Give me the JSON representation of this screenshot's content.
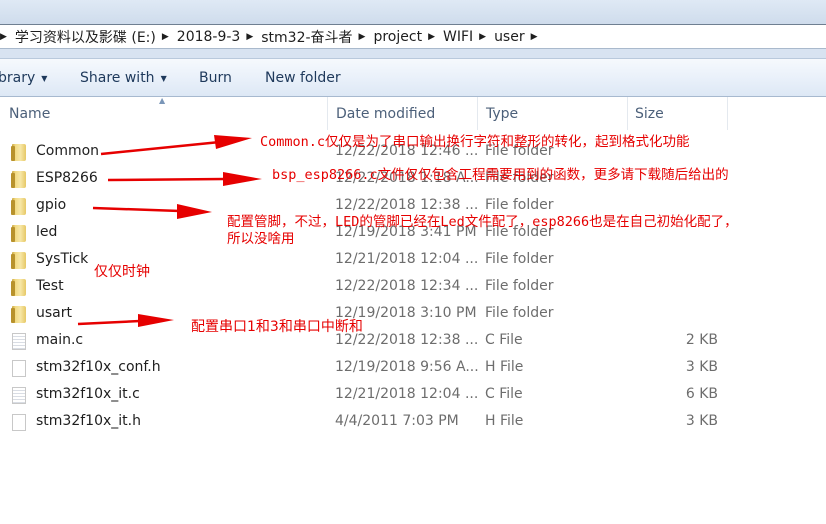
{
  "address_bar": {
    "breadcrumbs": [
      "学习资料以及影碟 (E:)",
      "2018-9-3",
      "stm32-奋斗者",
      "project",
      "WIFI",
      "user"
    ]
  },
  "toolbar": {
    "library_label": "brary",
    "share_with_label": "Share with",
    "burn_label": "Burn",
    "new_folder_label": "New folder"
  },
  "columns": {
    "name": "Name",
    "date_modified": "Date modified",
    "type": "Type",
    "size": "Size",
    "sort_column": "Name",
    "sort_direction": "ascending"
  },
  "files": [
    {
      "name": "Common",
      "date": "12/22/2018 12:46 ...",
      "type": "File folder",
      "size": "",
      "icon": "folder-icon"
    },
    {
      "name": "ESP8266",
      "date": "12/22/2018 1:18 A...",
      "type": "File folder",
      "size": "",
      "icon": "folder-icon"
    },
    {
      "name": "gpio",
      "date": "12/22/2018 12:38 ...",
      "type": "File folder",
      "size": "",
      "icon": "folder-icon"
    },
    {
      "name": "led",
      "date": "12/19/2018 3:41 PM",
      "type": "File folder",
      "size": "",
      "icon": "folder-icon"
    },
    {
      "name": "SysTick",
      "date": "12/21/2018 12:04 ...",
      "type": "File folder",
      "size": "",
      "icon": "folder-icon"
    },
    {
      "name": "Test",
      "date": "12/22/2018 12:34 ...",
      "type": "File folder",
      "size": "",
      "icon": "folder-icon"
    },
    {
      "name": "usart",
      "date": "12/19/2018 3:10 PM",
      "type": "File folder",
      "size": "",
      "icon": "folder-icon"
    },
    {
      "name": "main.c",
      "date": "12/22/2018 12:38 ...",
      "type": "C File",
      "size": "2 KB",
      "icon": "c-file-icon"
    },
    {
      "name": "stm32f10x_conf.h",
      "date": "12/19/2018 9:56 A...",
      "type": "H File",
      "size": "3 KB",
      "icon": "h-file-icon"
    },
    {
      "name": "stm32f10x_it.c",
      "date": "12/21/2018 12:04 ...",
      "type": "C File",
      "size": "6 KB",
      "icon": "c-file-icon"
    },
    {
      "name": "stm32f10x_it.h",
      "date": "4/4/2011 7:03 PM",
      "type": "H File",
      "size": "3 KB",
      "icon": "h-file-icon"
    }
  ],
  "annotations": {
    "common": "Common.c仅仅是为了串口输出换行字符和整形的转化，起到格式化功能",
    "esp8266": "bsp_esp8266.c文件仅仅包含工程需要用到的函数，更多请下载随后给出的",
    "gpio_line1": "配置管脚，不过，LED的管脚已经在Led文件配了，esp8266也是在自己初始化配了，",
    "gpio_line2": "所以没啥用",
    "systick": "仅仅时钟",
    "usart": "配置串口1和3和串口中断和"
  },
  "colors": {
    "annotation": "#e60000",
    "toolbar_text": "#1e395b",
    "secondary_text": "#6d6d6d"
  }
}
